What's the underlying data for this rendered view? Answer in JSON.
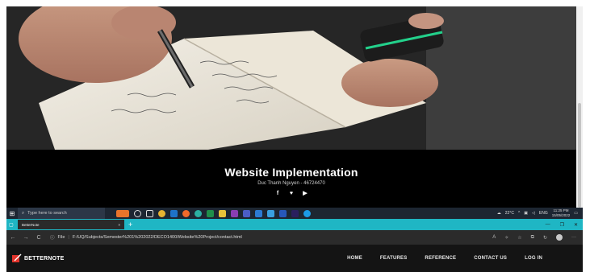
{
  "hero": {
    "image_description_icon": "notebook-writing-photo"
  },
  "footer": {
    "title": "Website Implementation",
    "author": "Duc Thanh Nguyen - 46724470",
    "social": [
      {
        "icon": "facebook-icon",
        "glyph": "f"
      },
      {
        "icon": "twitter-icon",
        "glyph": "♥"
      },
      {
        "icon": "youtube-icon",
        "glyph": "▶"
      }
    ]
  },
  "taskbar": {
    "search_placeholder": "Type here to search",
    "weather": "22°C",
    "lang": "ENG",
    "time": "11:25 PM",
    "date": "15/05/2022"
  },
  "browser": {
    "tab_title": "BetterNote",
    "tab_close": "×",
    "new_tab": "+",
    "min": "—",
    "max": "❐",
    "close": "✕",
    "back": "←",
    "forward": "→",
    "refresh": "C",
    "file_label": "File",
    "url": "F:/UQ/Subjects/Semester%201%202022/DECO1400/Website%20Project/contact.html"
  },
  "site": {
    "logo": "BETTERNOTE",
    "nav": [
      "HOME",
      "FEATURES",
      "REFERENCE",
      "CONTACT US",
      "LOG IN"
    ]
  },
  "colors": {
    "accent": "#1fb6c4",
    "nav_bg": "#141414",
    "brand_red": "#e0332b"
  }
}
